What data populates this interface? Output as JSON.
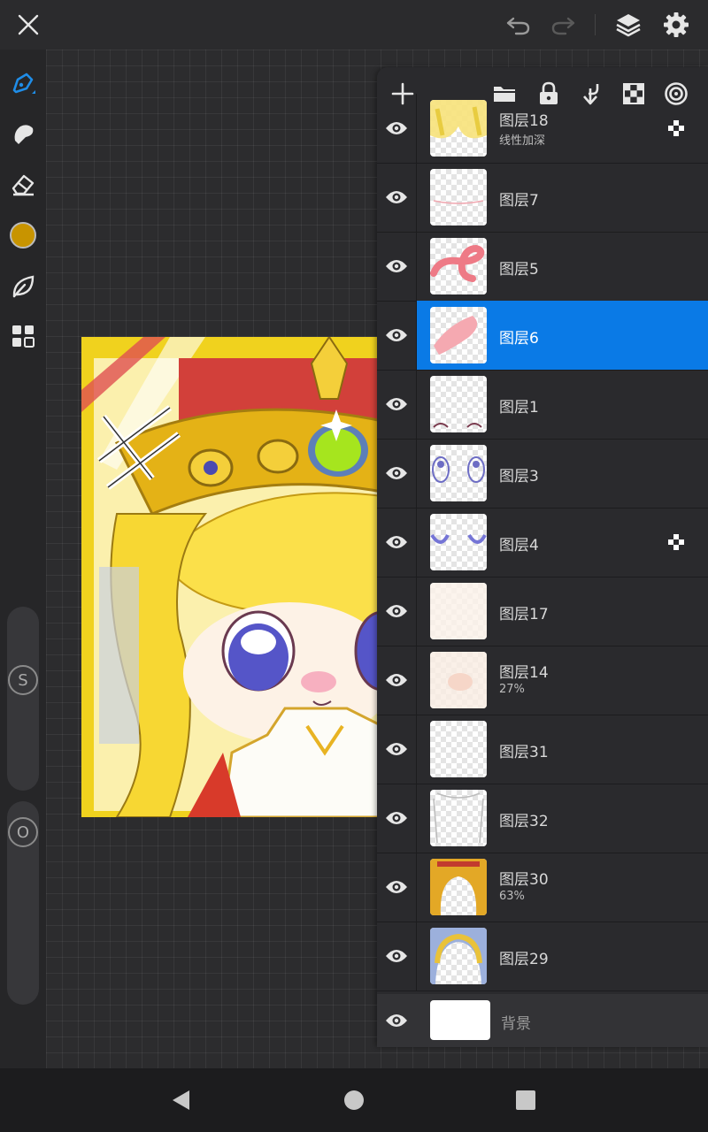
{
  "topbar": {
    "close_icon": "close-icon",
    "undo_icon": "undo-icon",
    "redo_icon": "redo-icon",
    "layers_icon": "layers-icon",
    "settings_icon": "gear-icon"
  },
  "toolbar": {
    "tools": [
      "brush-tool-icon",
      "smudge-tool-icon",
      "eraser-tool-icon",
      "color-swatch",
      "leaf-icon",
      "grid-icon"
    ],
    "current_color": "#c89400",
    "size_slider_label": "S",
    "opacity_slider_label": "O"
  },
  "layers_panel": {
    "toolbar_icons": [
      "add-layer-icon",
      "folder-icon",
      "lock-icon",
      "merge-down-icon",
      "checkerboard-icon",
      "target-icon"
    ],
    "layers": [
      {
        "name": "图层18",
        "sub": "线性加深",
        "alpha_lock": true,
        "selected": false
      },
      {
        "name": "图层7",
        "sub": "",
        "alpha_lock": false,
        "selected": false
      },
      {
        "name": "图层5",
        "sub": "",
        "alpha_lock": false,
        "selected": false
      },
      {
        "name": "图层6",
        "sub": "",
        "alpha_lock": false,
        "selected": true
      },
      {
        "name": "图层1",
        "sub": "",
        "alpha_lock": false,
        "selected": false
      },
      {
        "name": "图层3",
        "sub": "",
        "alpha_lock": false,
        "selected": false
      },
      {
        "name": "图层4",
        "sub": "",
        "alpha_lock": true,
        "selected": false
      },
      {
        "name": "图层17",
        "sub": "",
        "alpha_lock": false,
        "selected": false
      },
      {
        "name": "图层14",
        "sub": "27%",
        "alpha_lock": false,
        "selected": false
      },
      {
        "name": "图层31",
        "sub": "",
        "alpha_lock": false,
        "selected": false
      },
      {
        "name": "图层32",
        "sub": "",
        "alpha_lock": false,
        "selected": false
      },
      {
        "name": "图层30",
        "sub": "63%",
        "alpha_lock": false,
        "selected": false
      },
      {
        "name": "图层29",
        "sub": "",
        "alpha_lock": false,
        "selected": false
      }
    ],
    "background_layer": {
      "name": "背景"
    },
    "selected_color": "#0a7ae6"
  },
  "navbar": {
    "back_icon": "back-icon",
    "home_icon": "home-icon",
    "recents_icon": "recents-icon"
  }
}
